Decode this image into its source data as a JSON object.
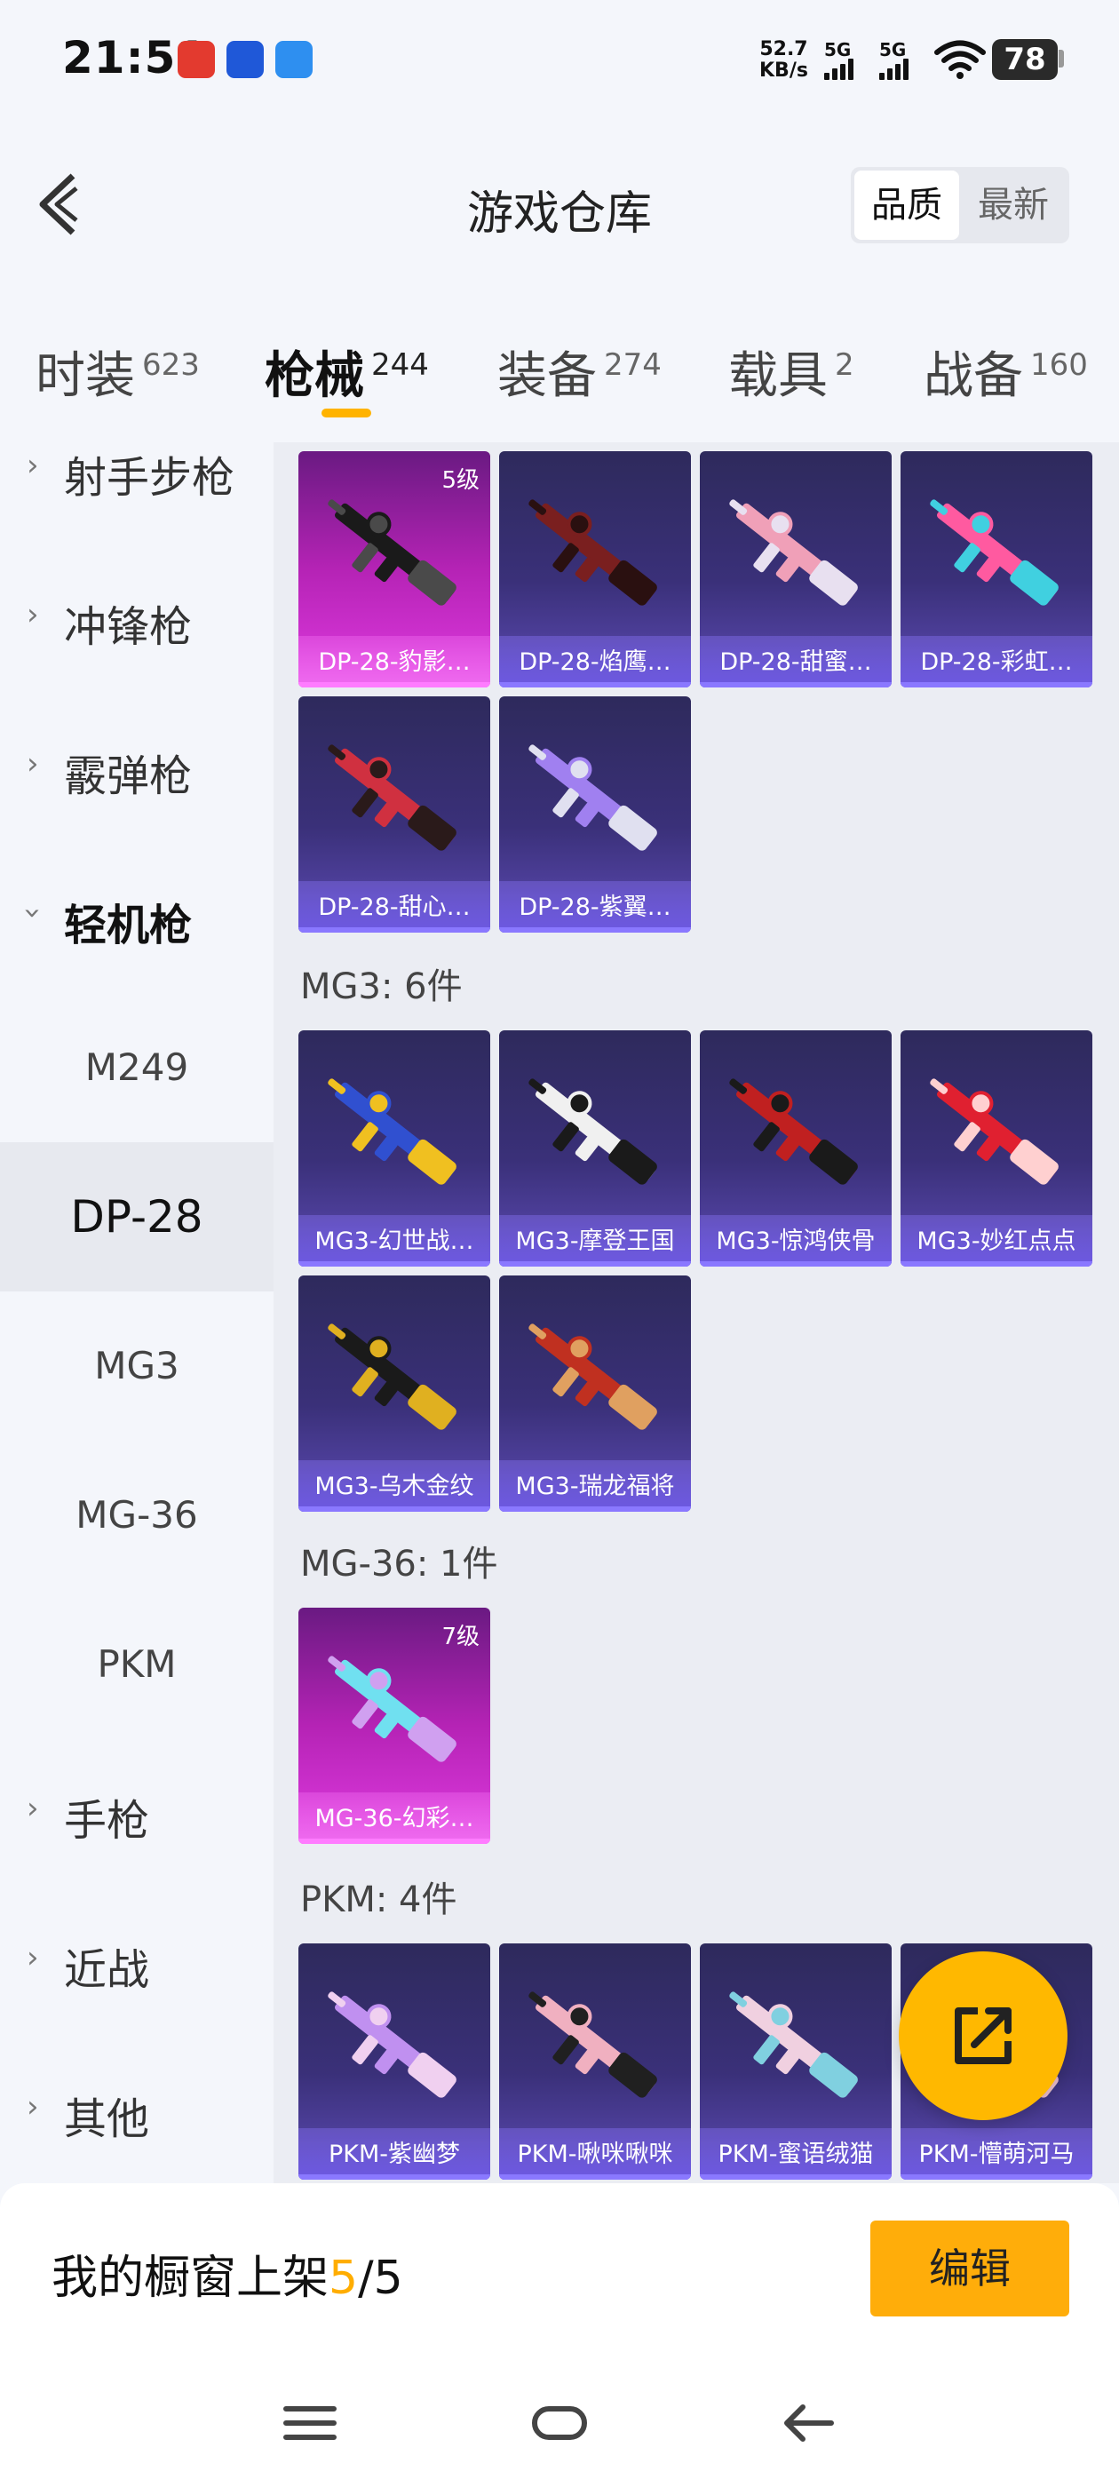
{
  "status_bar": {
    "time": "21:51",
    "net_speed_value": "52.7",
    "net_speed_unit": "KB/s",
    "signal1_label": "5G",
    "signal2_label": "5G",
    "battery": "78"
  },
  "header": {
    "title": "游戏仓库",
    "sort_options": [
      "品质",
      "最新"
    ],
    "active_sort": "品质"
  },
  "tabs": [
    {
      "label": "时装",
      "count": "623"
    },
    {
      "label": "枪械",
      "count": "244"
    },
    {
      "label": "装备",
      "count": "274"
    },
    {
      "label": "载具",
      "count": "2"
    },
    {
      "label": "战备",
      "count": "160"
    }
  ],
  "active_tab": "枪械",
  "sidebar": {
    "categories": [
      "射手步枪",
      "冲锋枪",
      "霰弹枪",
      "轻机枪",
      "手枪",
      "近战",
      "其他"
    ],
    "expanded": "轻机枪",
    "subcategories": [
      "M249",
      "DP-28",
      "MG3",
      "MG-36",
      "PKM"
    ],
    "active_sub": "DP-28"
  },
  "groups": {
    "dp28_items": [
      {
        "name": "DP-28-豹影…",
        "level": "5级",
        "rarity": "gold",
        "colors": [
          "#1a1a1a",
          "#4a4a4a"
        ]
      },
      {
        "name": "DP-28-焰鹰…",
        "rarity": "purple",
        "colors": [
          "#7a1f1f",
          "#2a1010"
        ]
      },
      {
        "name": "DP-28-甜蜜…",
        "rarity": "purple",
        "colors": [
          "#f0a0b8",
          "#e8e0f0"
        ]
      },
      {
        "name": "DP-28-彩虹…",
        "rarity": "purple",
        "colors": [
          "#ff5aa0",
          "#40d0e0"
        ]
      },
      {
        "name": "DP-28-甜心…",
        "rarity": "purple",
        "colors": [
          "#d03040",
          "#2a1a1a"
        ]
      },
      {
        "name": "DP-28-紫翼…",
        "rarity": "purple",
        "colors": [
          "#a080f0",
          "#e0e0f0"
        ]
      }
    ],
    "mg3": {
      "label": "MG3: 6件",
      "items": [
        {
          "name": "MG3-幻世战…",
          "rarity": "purple",
          "colors": [
            "#3050d0",
            "#f0c020"
          ]
        },
        {
          "name": "MG3-摩登王国",
          "rarity": "purple",
          "colors": [
            "#f0f0f0",
            "#1a1a1a"
          ]
        },
        {
          "name": "MG3-惊鸿侠骨",
          "rarity": "purple",
          "colors": [
            "#c02020",
            "#1a1a1a"
          ]
        },
        {
          "name": "MG3-妙红点点",
          "rarity": "purple",
          "colors": [
            "#e02030",
            "#ffd0d0"
          ]
        },
        {
          "name": "MG3-乌木金纹",
          "rarity": "purple",
          "colors": [
            "#1a1a1a",
            "#e0b020"
          ]
        },
        {
          "name": "MG3-瑞龙福将",
          "rarity": "purple",
          "colors": [
            "#c03020",
            "#e0a060"
          ]
        }
      ]
    },
    "mg36": {
      "label": "MG-36: 1件",
      "items": [
        {
          "name": "MG-36-幻彩…",
          "level": "7级",
          "rarity": "gold",
          "colors": [
            "#70e0f0",
            "#d0a0f0"
          ]
        }
      ]
    },
    "pkm": {
      "label": "PKM: 4件",
      "items": [
        {
          "name": "PKM-紫幽梦",
          "rarity": "purple",
          "colors": [
            "#c090f0",
            "#f0d0f0"
          ]
        },
        {
          "name": "PKM-啾咪啾咪",
          "rarity": "purple",
          "colors": [
            "#f0b0c0",
            "#202020"
          ]
        },
        {
          "name": "PKM-蜜语绒猫",
          "rarity": "purple",
          "colors": [
            "#f0d0e0",
            "#80d0e0"
          ]
        },
        {
          "name": "PKM-懵萌河马",
          "rarity": "purple",
          "colors": [
            "#80e0a0",
            "#f0c0d0"
          ]
        }
      ]
    }
  },
  "bottom_bar": {
    "showcase_prefix": "我的橱窗上架",
    "showcase_count": "5",
    "showcase_total": "/5",
    "edit_label": "编辑"
  },
  "icons": {
    "back": "chevron-left-icon",
    "share": "share-export-icon",
    "nav_menu": "menu-icon",
    "nav_home": "home-icon",
    "nav_back": "back-arrow-icon"
  },
  "colors": {
    "accent": "#ffad0a",
    "gold_card": "#c22dc3",
    "purple_card": "#3a3079"
  }
}
